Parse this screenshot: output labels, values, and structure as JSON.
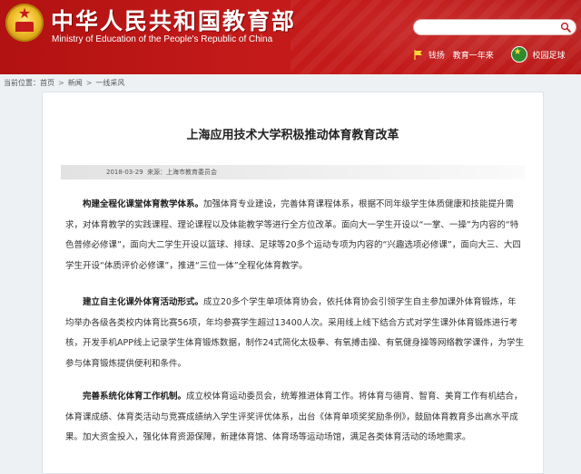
{
  "header": {
    "title": "中华人民共和国教育部",
    "subtitle": "Ministry of Education of the People's Republic of China",
    "search_placeholder": "",
    "links": {
      "nobel": "钱扬",
      "year": "教育一年来",
      "football": "校园足球"
    }
  },
  "breadcrumb": {
    "label": "当前位置：",
    "items": [
      "首页",
      "新闻",
      "一线采风"
    ],
    "separator": ">"
  },
  "article": {
    "title": "上海应用技术大学积极推动体育教育改革",
    "date": "2018-03-29",
    "source": "来源：上海市教育委员会",
    "paragraphs": [
      {
        "lead": "构建全程化课堂体育教学体系。",
        "body": "加强体育专业建设，完善体育课程体系，根据不同年级学生体质健康和技能提升需求，对体育教学的实践课程、理论课程以及体能教学等进行全方位改革。面向大一学生开设以“一掌、一操”为内容的“特色普修必修课”，面向大二学生开设以篮球、排球、足球等20多个运动专项为内容的“兴趣选项必修课”，面向大三、大四学生开设“体质评价必修课”，推进“三位一体”全程化体育教学。"
      },
      {
        "lead": "建立自主化课外体育活动形式。",
        "body": "成立20多个学生单项体育协会，依托体育协会引领学生自主参加课外体育锻炼，年均举办各级各类校内体育比赛56项，年均参赛学生超过13400人次。采用线上线下结合方式对学生课外体育锻炼进行考核，开发手机APP线上记录学生体育锻炼数据，制作24式简化太极拳、有氧搏击操、有氧健身操等网络教学课件，为学生参与体育锻炼提供便利和条件。"
      },
      {
        "lead": "完善系统化体育工作机制。",
        "body": "成立校体育运动委员会，统筹推进体育工作。将体育与德育、智育、美育工作有机结合，体育课成绩、体育类活动与竞赛成绩纳入学生评奖评优体系，出台《体育单项奖奖励条例》，鼓励体育教育多出高水平成果。加大资金投入，强化体育资源保障，新建体育馆、体育场等运动场馆，满足各类体育活动的场地需求。"
      }
    ]
  },
  "colors": {
    "header_red": "#c41a1a",
    "page_bg": "#eef1f4",
    "article_bg": "#ffffff"
  },
  "icons": [
    "national-emblem-icon",
    "search-icon",
    "flag-icon",
    "football-icon"
  ]
}
